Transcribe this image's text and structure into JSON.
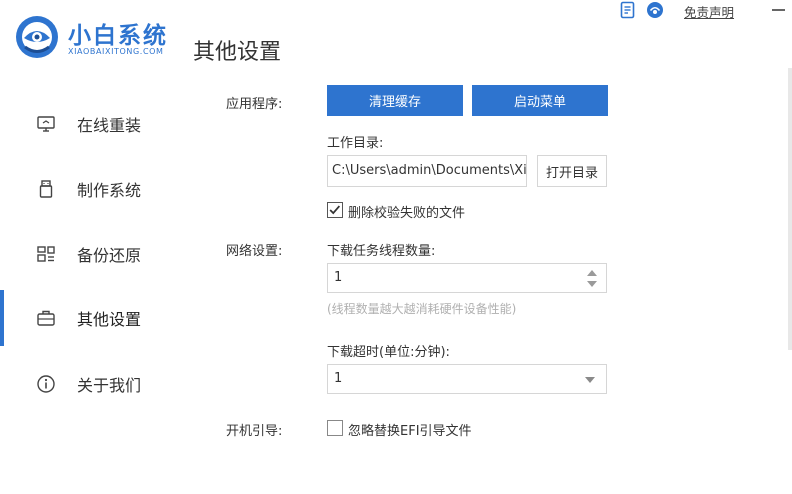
{
  "app": {
    "name": "小白系统",
    "subtitle": "XIAOBAIXITONG.COM",
    "page_title": "其他设置",
    "disclaimer": "免责声明"
  },
  "sidebar": {
    "items": [
      {
        "label": "在线重装",
        "icon": "monitor-icon"
      },
      {
        "label": "制作系统",
        "icon": "usb-icon"
      },
      {
        "label": "备份还原",
        "icon": "backup-icon"
      },
      {
        "label": "其他设置",
        "icon": "briefcase-icon",
        "active": true
      },
      {
        "label": "关于我们",
        "icon": "info-icon"
      }
    ]
  },
  "app_section": {
    "label": "应用程序:",
    "clear_cache_button": "清理缓存",
    "boot_menu_button": "启动菜单",
    "workdir_label": "工作目录:",
    "workdir_value": "C:\\Users\\admin\\Documents\\Xia",
    "open_dir_button": "打开目录",
    "delete_failed_label": "删除校验失败的文件",
    "delete_failed_checked": true
  },
  "network_section": {
    "label": "网络设置:",
    "threads_label": "下载任务线程数量:",
    "threads_value": "1",
    "threads_hint": "(线程数量越大越消耗硬件设备性能)",
    "timeout_label": "下载超时(单位:分钟):",
    "timeout_value": "1"
  },
  "boot_section": {
    "label": "开机引导:",
    "ignore_efi_label": "忽略替换EFI引导文件",
    "ignore_efi_checked": false
  },
  "colors": {
    "accent": "#2e74cf",
    "text": "#333333",
    "hint": "#b0b0b0"
  }
}
